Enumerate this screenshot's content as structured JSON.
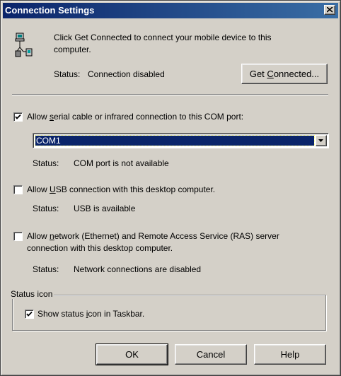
{
  "window": {
    "title": "Connection Settings",
    "close_icon": "close-icon"
  },
  "intro": {
    "icon": "pc-device-connection-icon",
    "text_line1": "Click Get Connected to connect your mobile device to this",
    "text_line2": "computer.",
    "status_label": "Status:",
    "status_value": "Connection disabled",
    "get_connected_pre": "Get ",
    "get_connected_u": "C",
    "get_connected_post": "onnected..."
  },
  "serial": {
    "checked": true,
    "label_pre": "Allow ",
    "label_u": "s",
    "label_post": "erial cable or infrared connection to this COM port:",
    "combo_value": "COM1",
    "status_label": "Status:",
    "status_value": "COM port is not available"
  },
  "usb": {
    "checked": false,
    "label_pre": "Allow ",
    "label_u": "U",
    "label_post": "SB connection with this desktop computer.",
    "status_label": "Status:",
    "status_value": "USB is available"
  },
  "network": {
    "checked": false,
    "label_pre": "Allow ",
    "label_u": "n",
    "label_post": "etwork (Ethernet) and Remote Access Service (RAS) server",
    "label_line2": "connection with this desktop computer.",
    "status_label": "Status:",
    "status_value": "Network connections are disabled"
  },
  "status_icon_group": {
    "legend": "Status icon",
    "checked": true,
    "label_pre": "Show status ",
    "label_u": "i",
    "label_post": "con in Taskbar."
  },
  "buttons": {
    "ok": "OK",
    "cancel": "Cancel",
    "help": "Help"
  }
}
